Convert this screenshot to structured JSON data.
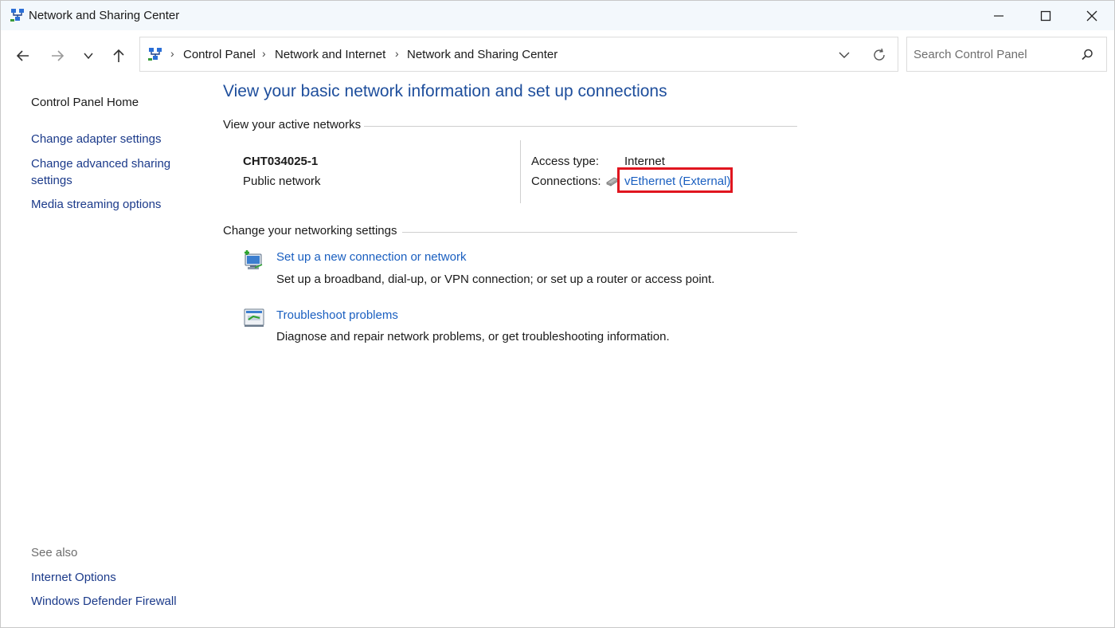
{
  "window": {
    "title": "Network and Sharing Center"
  },
  "address_bar": {
    "breadcrumbs": [
      "Control Panel",
      "Network and Internet",
      "Network and Sharing Center"
    ]
  },
  "search": {
    "placeholder": "Search Control Panel"
  },
  "sidebar": {
    "home": "Control Panel Home",
    "links": [
      "Change adapter settings",
      "Change advanced sharing",
      "settings",
      "Media streaming options"
    ],
    "see_also_title": "See also",
    "see_also": [
      "Internet Options",
      "Windows Defender Firewall"
    ]
  },
  "main": {
    "title": "View your basic network information and set up connections",
    "active_networks_heading": "View your active networks",
    "network": {
      "name": "CHT034025-1",
      "type": "Public network",
      "access_type_label": "Access type:",
      "access_type_value": "Internet",
      "connections_label": "Connections:",
      "connection_link": "vEthernet (External)"
    },
    "settings_heading": "Change your networking settings",
    "tasks": [
      {
        "link": "Set up a new connection or network",
        "desc": "Set up a broadband, dial-up, or VPN connection; or set up a router or access point."
      },
      {
        "link": "Troubleshoot problems",
        "desc": "Diagnose and repair network problems, or get troubleshooting information."
      }
    ]
  },
  "colors": {
    "link": "#1a5fc0",
    "title": "#1e4e9c",
    "highlight": "#e0151f",
    "titlebar": "#f3f8fc"
  }
}
